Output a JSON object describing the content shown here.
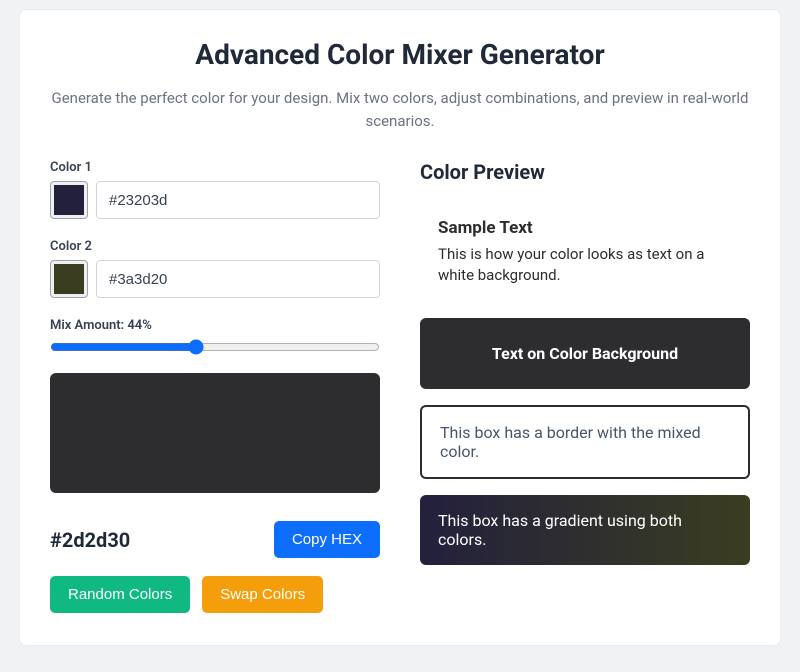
{
  "title": "Advanced Color Mixer Generator",
  "subtitle": "Generate the perfect color for your design. Mix two colors, adjust combinations, and preview in real-world scenarios.",
  "color1": {
    "label": "Color 1",
    "value": "#23203d"
  },
  "color2": {
    "label": "Color 2",
    "value": "#3a3d20"
  },
  "mix": {
    "percent": 44,
    "label_prefix": "Mix Amount: ",
    "label_suffix": "%"
  },
  "mixed_hex": "#2d2d30",
  "buttons": {
    "copy": "Copy HEX",
    "random": "Random Colors",
    "swap": "Swap Colors"
  },
  "preview": {
    "title": "Color Preview",
    "sample_heading": "Sample Text",
    "sample_desc": "This is how your color looks as text on a white background.",
    "dark_text": "Text on Color Background",
    "border_text": "This box has a border with the mixed color.",
    "gradient_text": "This box has a gradient using both colors."
  }
}
